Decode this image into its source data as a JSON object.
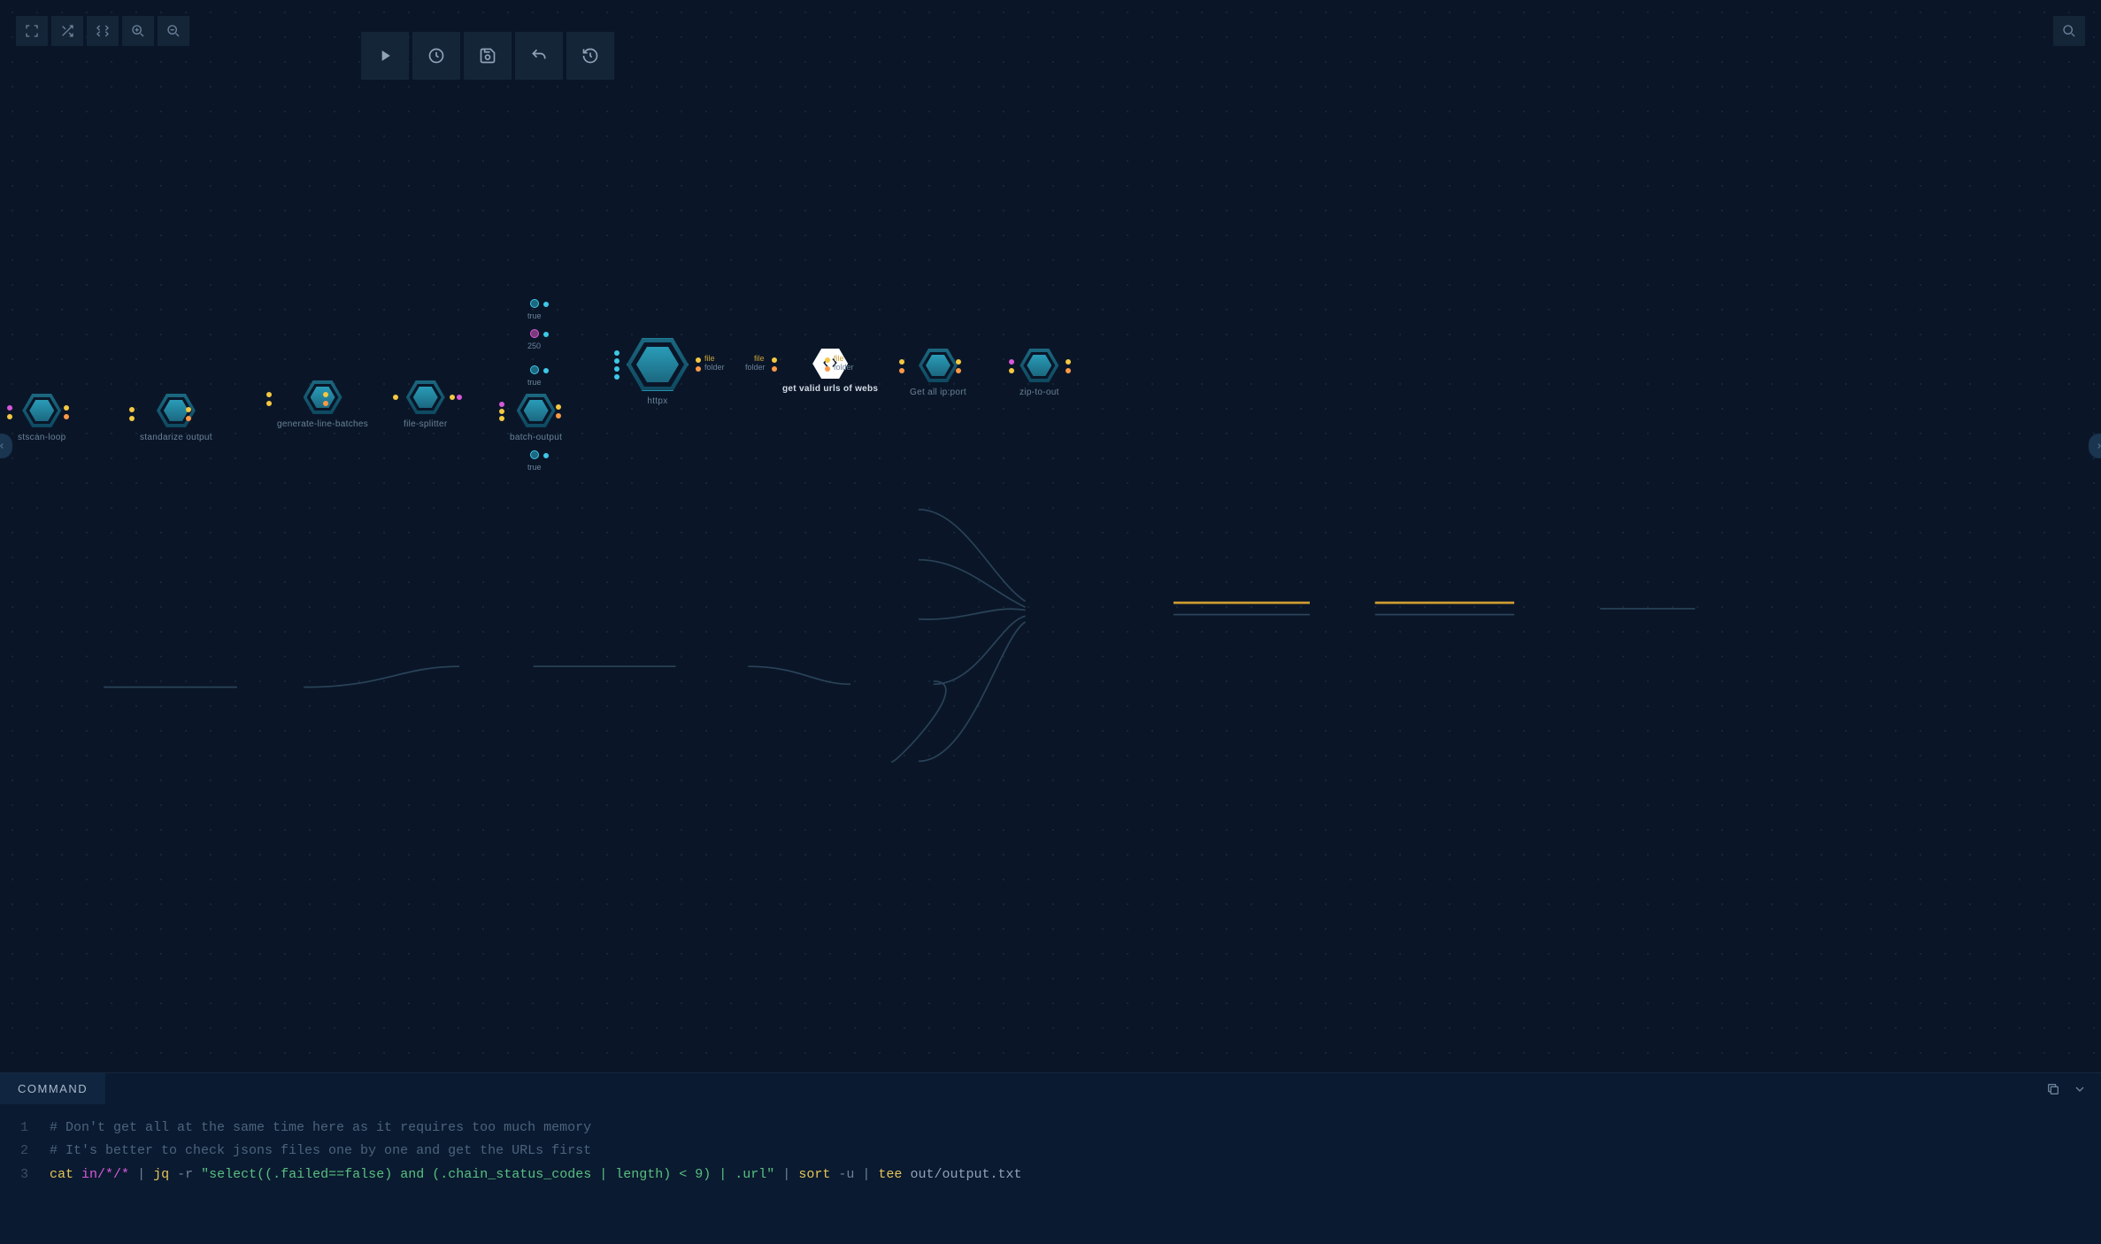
{
  "colors": {
    "bg": "#0a1628",
    "panel": "#142538",
    "accent": "#3ec8e6",
    "yellow": "#f5c842",
    "magenta": "#d858d8",
    "orange": "#ff9947",
    "green": "#58c080"
  },
  "toolbar": {
    "mini": [
      "fullscreen",
      "shuffle",
      "arrange",
      "zoom-in",
      "zoom-out"
    ],
    "actions": [
      "run",
      "schedule",
      "save",
      "undo",
      "history"
    ],
    "search": "search"
  },
  "side_handles": {
    "left": "<",
    "right": ">"
  },
  "graph": {
    "intermediates": [
      {
        "id": "int-true-1",
        "label": "true"
      },
      {
        "id": "int-250",
        "label": "250"
      },
      {
        "id": "int-true-2",
        "label": "true"
      },
      {
        "id": "int-true-3",
        "label": "true"
      }
    ],
    "nodes": [
      {
        "id": "n1",
        "label": "stscan-loop"
      },
      {
        "id": "n2",
        "label": "standarize output"
      },
      {
        "id": "n3",
        "label": "generate-line-batches"
      },
      {
        "id": "n4",
        "label": "file-splitter"
      },
      {
        "id": "n5",
        "label": "batch-output"
      },
      {
        "id": "n6",
        "label": "httpx",
        "large": true
      },
      {
        "id": "n7",
        "label": "get valid urls of webs",
        "white": true,
        "selected": true
      },
      {
        "id": "n8",
        "label": "Get all ip:port"
      },
      {
        "id": "n9",
        "label": "zip-to-out"
      }
    ],
    "port_labels": {
      "file1": "file",
      "folder1": "folder",
      "file2": "file",
      "folder2": "folder",
      "file3": "file",
      "folder3": "folder"
    }
  },
  "panel": {
    "tab": "COMMAND",
    "icons": [
      "copy",
      "expand"
    ],
    "code": {
      "l1_comment": "# Don't get all at the same time here as it requires too much memory",
      "l2_comment": "# It's better to check jsons files one by one and get the URLs first",
      "l3": {
        "cmd1": "cat",
        "path": "in/*/*",
        "pipe": "|",
        "cmd2": "jq",
        "flag1": "-r",
        "str": "\"select((.failed==false) and (.chain_status_codes | length) < 9) | .url\"",
        "cmd3": "sort",
        "flag2": "-u",
        "cmd4": "tee",
        "out": "out/output.txt"
      }
    }
  }
}
